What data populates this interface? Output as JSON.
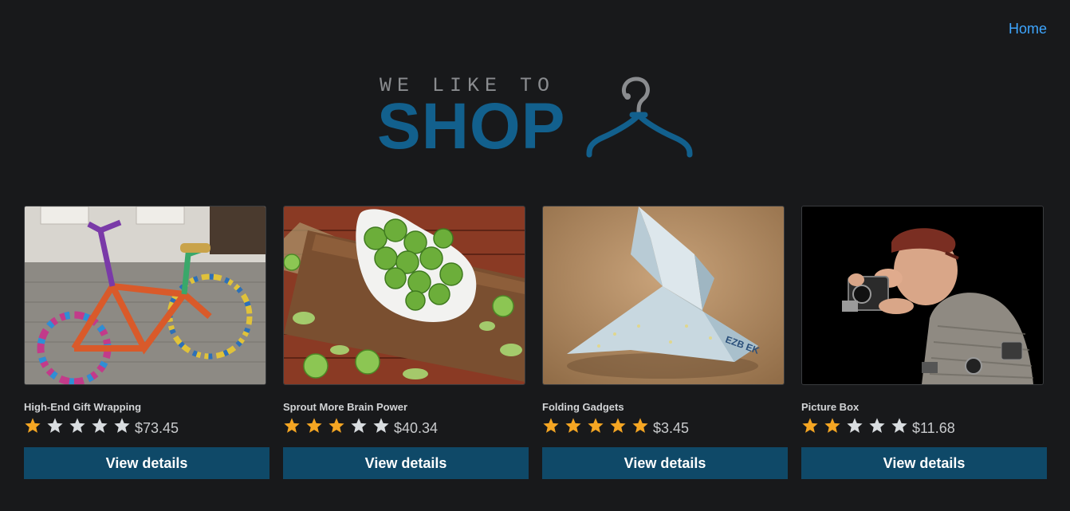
{
  "nav": {
    "home_label": "Home"
  },
  "logo": {
    "tagline": "WE LIKE TO",
    "word": "SHOP",
    "icon": "hanger-icon"
  },
  "colors": {
    "background": "#18191b",
    "link": "#3ea6ff",
    "brand": "#12608d",
    "button": "#0f4968",
    "star_filled": "#f5a623",
    "star_empty": "#d9dde0"
  },
  "products": [
    {
      "title": "High-End Gift Wrapping",
      "rating": 1,
      "max_rating": 5,
      "price": "$73.45",
      "button_label": "View details",
      "image": "yarn-bombed-bicycle"
    },
    {
      "title": "Sprout More Brain Power",
      "rating": 3,
      "max_rating": 5,
      "price": "$40.34",
      "button_label": "View details",
      "image": "brussels-sprouts-bowl"
    },
    {
      "title": "Folding Gadgets",
      "rating": 5,
      "max_rating": 5,
      "price": "$3.45",
      "button_label": "View details",
      "image": "origami-bird"
    },
    {
      "title": "Picture Box",
      "rating": 2,
      "max_rating": 5,
      "price": "$11.68",
      "button_label": "View details",
      "image": "photographer-figurine"
    }
  ]
}
